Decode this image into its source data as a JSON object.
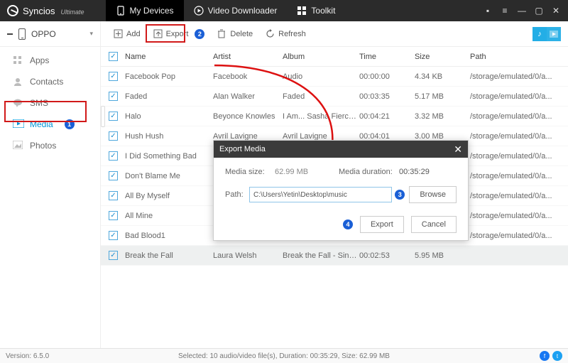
{
  "brand": {
    "name": "Syncios",
    "edition": "Ultimate"
  },
  "nav": {
    "devices": "My Devices",
    "downloader": "Video Downloader",
    "toolkit": "Toolkit"
  },
  "device": "OPPO",
  "sidebar": {
    "items": [
      {
        "label": "Apps"
      },
      {
        "label": "Contacts"
      },
      {
        "label": "SMS"
      },
      {
        "label": "Media"
      },
      {
        "label": "Photos"
      }
    ]
  },
  "toolbar": {
    "add": "Add",
    "export": "Export",
    "delete": "Delete",
    "refresh": "Refresh"
  },
  "columns": {
    "name": "Name",
    "artist": "Artist",
    "album": "Album",
    "time": "Time",
    "size": "Size",
    "path": "Path"
  },
  "rows": [
    {
      "name": "Facebook Pop",
      "artist": "Facebook",
      "album": "Audio",
      "time": "00:00:00",
      "size": "4.34 KB",
      "path": "/storage/emulated/0/a..."
    },
    {
      "name": "Faded",
      "artist": "Alan Walker",
      "album": "Faded",
      "time": "00:03:35",
      "size": "5.17 MB",
      "path": "/storage/emulated/0/a..."
    },
    {
      "name": "Halo",
      "artist": "Beyonce Knowles",
      "album": "I Am... Sasha Fierce (D...",
      "time": "00:04:21",
      "size": "3.32 MB",
      "path": "/storage/emulated/0/a..."
    },
    {
      "name": "Hush Hush",
      "artist": "Avril Lavigne",
      "album": "Avril Lavigne",
      "time": "00:04:01",
      "size": "3.00 MB",
      "path": "/storage/emulated/0/a..."
    },
    {
      "name": "I Did Something Bad",
      "artist": "",
      "album": "",
      "time": "",
      "size": "",
      "path": "/storage/emulated/0/a..."
    },
    {
      "name": "Don't Blame Me",
      "artist": "",
      "album": "",
      "time": "",
      "size": "",
      "path": "/storage/emulated/0/a..."
    },
    {
      "name": "All By Myself",
      "artist": "",
      "album": "",
      "time": "",
      "size": "",
      "path": "/storage/emulated/0/a..."
    },
    {
      "name": "All Mine",
      "artist": "",
      "album": "",
      "time": "",
      "size": "",
      "path": "/storage/emulated/0/a..."
    },
    {
      "name": "Bad Blood1",
      "artist": "",
      "album": "",
      "time": "",
      "size": "",
      "path": "/storage/emulated/0/a..."
    },
    {
      "name": "Break the Fall",
      "artist": "Laura Welsh",
      "album": "Break the Fall - Single",
      "time": "00:02:53",
      "size": "5.95 MB",
      "path": ""
    }
  ],
  "modal": {
    "title": "Export Media",
    "size_label": "Media size:",
    "size_value": "62.99 MB",
    "dur_label": "Media duration:",
    "dur_value": "00:35:29",
    "path_label": "Path:",
    "path_value": "C:\\Users\\Yetin\\Desktop\\music",
    "browse": "Browse",
    "export": "Export",
    "cancel": "Cancel"
  },
  "status": {
    "version": "Version: 6.5.0",
    "selected": "Selected: 10 audio/video file(s), Duration: 00:35:29, Size: 62.99 MB"
  },
  "badges": {
    "b1": "1",
    "b2": "2",
    "b3": "3",
    "b4": "4"
  }
}
